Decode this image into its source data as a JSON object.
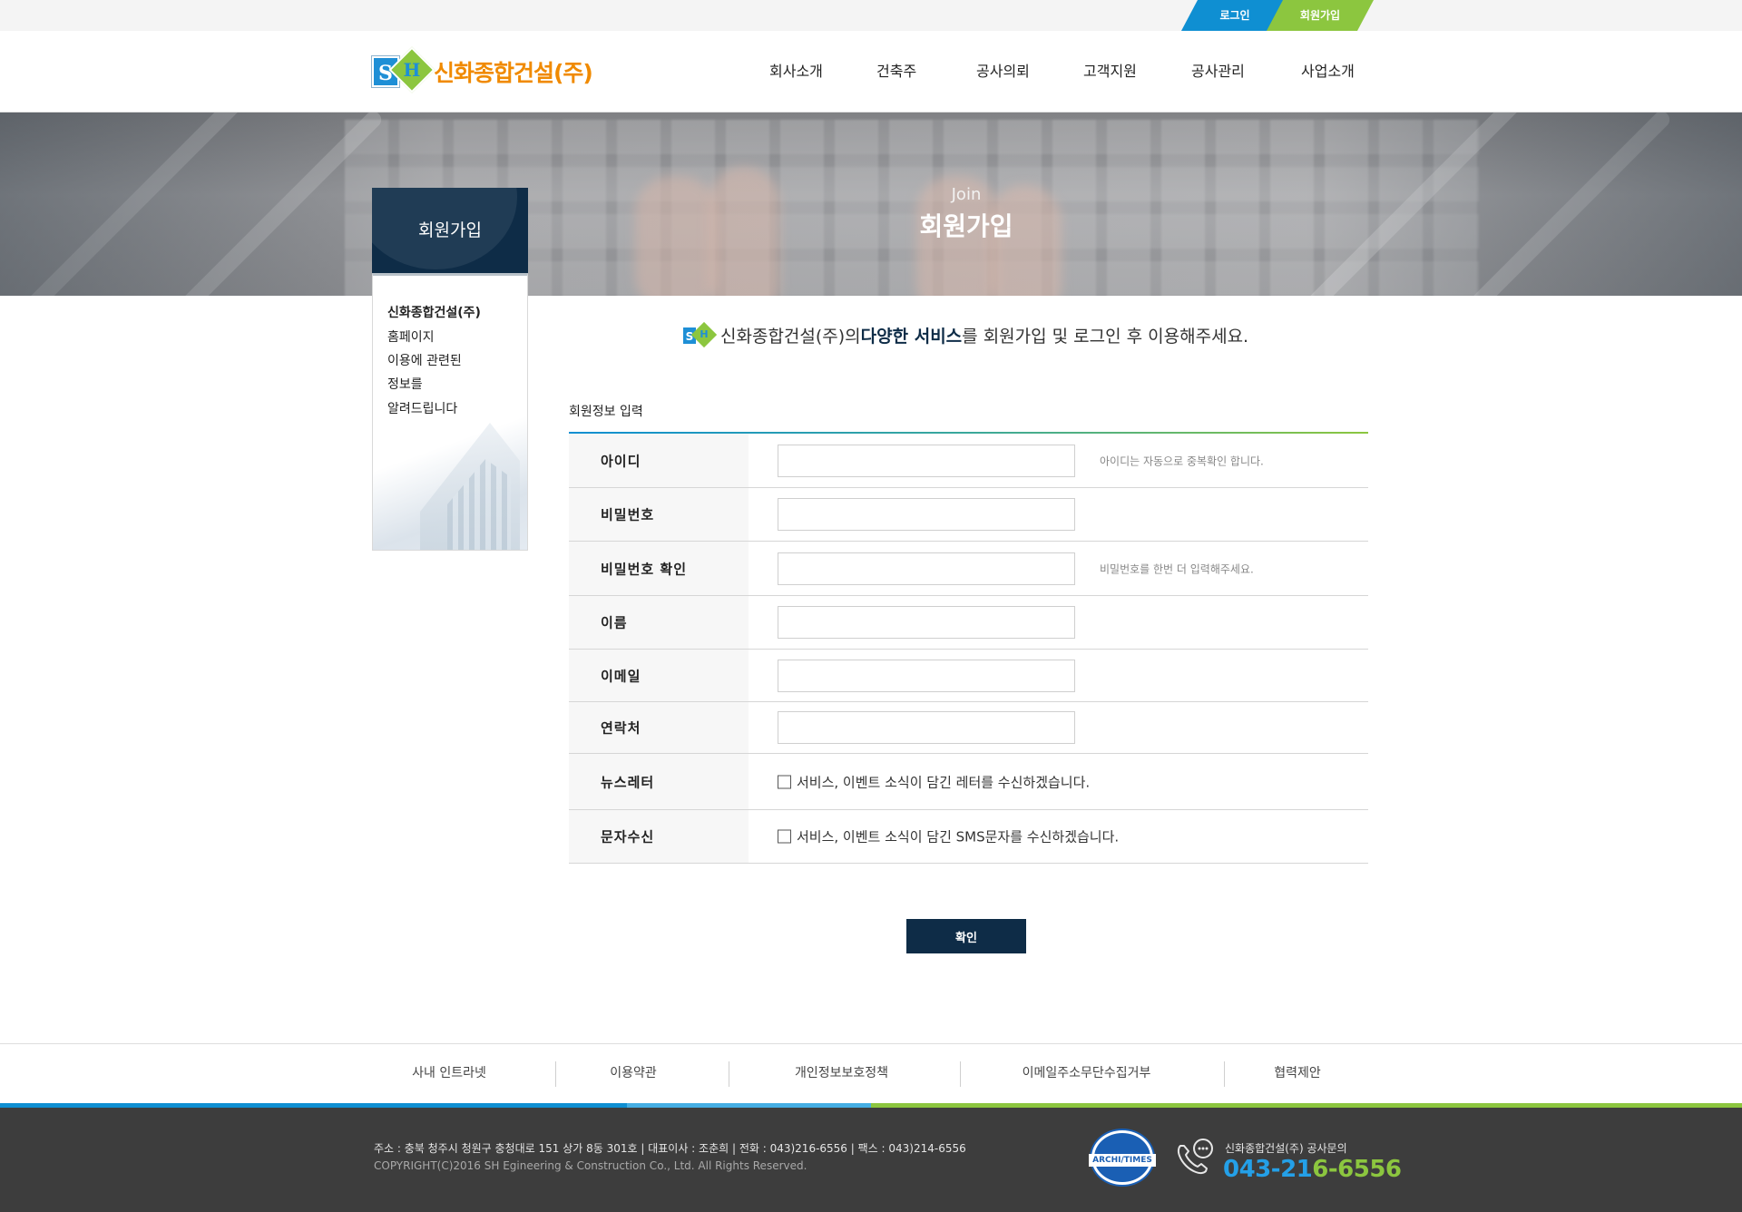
{
  "util": {
    "login": "로그인",
    "join": "회원가입"
  },
  "header": {
    "logo_text": "신화종합건설(주)",
    "logo_letters": [
      "S",
      "H"
    ],
    "nav": [
      "회사소개",
      "건축주",
      "공사의뢰",
      "고객지원",
      "공사관리",
      "사업소개"
    ]
  },
  "banner": {
    "sub": "Join",
    "title": "회원가입"
  },
  "side": {
    "title": "회원가입",
    "lines": [
      "신화종합건설(주)",
      "홈페이지",
      "이용에 관련된",
      "정보를",
      "알려드립니다"
    ]
  },
  "intro": {
    "pre": "신화종합건설(주)의 ",
    "bold": "다양한 서비스",
    "post": "를 회원가입 및 로그인 후 이용해주세요."
  },
  "form": {
    "caption": "회원정보 입력",
    "fields": [
      {
        "label": "아이디",
        "value": "",
        "hint": "아이디는 자동으로 중복확인 합니다."
      },
      {
        "label": "비밀번호",
        "value": "",
        "hint": ""
      },
      {
        "label": "비밀번호 확인",
        "value": "",
        "hint": "비밀번호를 한번 더 입력해주세요."
      },
      {
        "label": "이름",
        "value": "",
        "hint": ""
      },
      {
        "label": "이메일",
        "value": "",
        "hint": ""
      },
      {
        "label": "연락처",
        "value": "",
        "hint": ""
      }
    ],
    "checks": [
      {
        "label": "뉴스레터",
        "text": "서비스, 이벤트 소식이 담긴 레터를 수신하겠습니다.",
        "checked": false
      },
      {
        "label": "문자수신",
        "text": "서비스, 이벤트 소식이 담긴 SMS문자를 수신하겠습니다.",
        "checked": false
      }
    ],
    "submit": "확인"
  },
  "footer": {
    "links": [
      "사내 인트라넷",
      "이용약관",
      "개인정보보호정책",
      "이메일주소무단수집거부",
      "협력제안"
    ],
    "address": "주소 : 충북 청주시 청원구 충청대로 151 상가 8동 301호  |  대표이사 : 조춘희  |  전화 : 043)216-6556  |  팩스 : 043)214-6556",
    "copyright": "COPYRIGHT(C)2016  SH Egineering & Construction  Co., Ltd. All Rights Reserved.",
    "seal_text": "ARCHI/TIMES",
    "phone_label": "신화종합건설(주) 공사문의",
    "phone_part1": "043-21",
    "phone_part2": "6-6556"
  },
  "colors": {
    "navy": "#0e2c47",
    "blue": "#0f8fd2",
    "green": "#8cc63f",
    "orange": "#f08a00"
  }
}
